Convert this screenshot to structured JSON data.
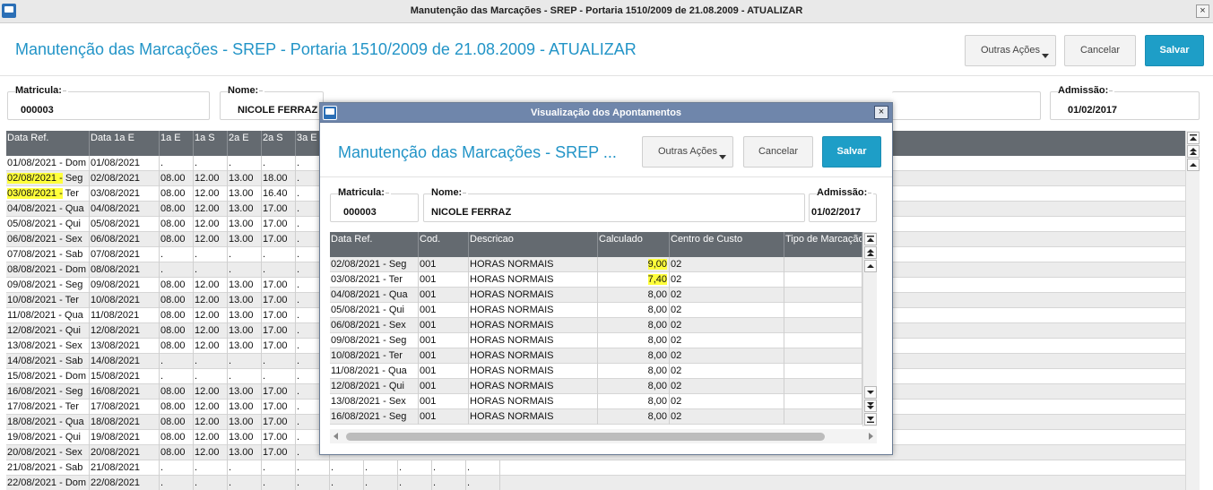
{
  "window": {
    "title": "Manutenção das Marcações - SREP - Portaria 1510/2009 de 21.08.2009 - ATUALIZAR",
    "close": "×"
  },
  "header": {
    "title": "Manutenção das Marcações - SREP - Portaria 1510/2009 de 21.08.2009 - ATUALIZAR",
    "outras_acoes": "Outras Ações",
    "cancelar": "Cancelar",
    "salvar": "Salvar"
  },
  "fields": {
    "matricula_label": "Matricula:",
    "matricula": "000003",
    "nome_label": "Nome:",
    "nome": "NICOLE FERRAZ",
    "admissao_label": "Admissão:",
    "admissao": "01/02/2017"
  },
  "grid": {
    "columns": [
      "Data Ref.",
      "Data 1a E",
      "1a E",
      "1a S",
      "2a E",
      "2a S",
      "3a E"
    ],
    "rows": [
      [
        "01/08/2021 - Dom",
        "01/08/2021",
        ".",
        ".",
        ".",
        ".",
        "."
      ],
      [
        "02/08/2021 - Seg",
        "02/08/2021",
        "08.00",
        "12.00",
        "13.00",
        "18.00",
        "."
      ],
      [
        "03/08/2021 - Ter",
        "03/08/2021",
        "08.00",
        "12.00",
        "13.00",
        "16.40",
        "."
      ],
      [
        "04/08/2021 - Qua",
        "04/08/2021",
        "08.00",
        "12.00",
        "13.00",
        "17.00",
        "."
      ],
      [
        "05/08/2021 - Qui",
        "05/08/2021",
        "08.00",
        "12.00",
        "13.00",
        "17.00",
        "."
      ],
      [
        "06/08/2021 - Sex",
        "06/08/2021",
        "08.00",
        "12.00",
        "13.00",
        "17.00",
        "."
      ],
      [
        "07/08/2021 - Sab",
        "07/08/2021",
        ".",
        ".",
        ".",
        ".",
        "."
      ],
      [
        "08/08/2021 - Dom",
        "08/08/2021",
        ".",
        ".",
        ".",
        ".",
        "."
      ],
      [
        "09/08/2021 - Seg",
        "09/08/2021",
        "08.00",
        "12.00",
        "13.00",
        "17.00",
        "."
      ],
      [
        "10/08/2021 - Ter",
        "10/08/2021",
        "08.00",
        "12.00",
        "13.00",
        "17.00",
        "."
      ],
      [
        "11/08/2021 - Qua",
        "11/08/2021",
        "08.00",
        "12.00",
        "13.00",
        "17.00",
        "."
      ],
      [
        "12/08/2021 - Qui",
        "12/08/2021",
        "08.00",
        "12.00",
        "13.00",
        "17.00",
        "."
      ],
      [
        "13/08/2021 - Sex",
        "13/08/2021",
        "08.00",
        "12.00",
        "13.00",
        "17.00",
        "."
      ],
      [
        "14/08/2021 - Sab",
        "14/08/2021",
        ".",
        ".",
        ".",
        ".",
        "."
      ],
      [
        "15/08/2021 - Dom",
        "15/08/2021",
        ".",
        ".",
        ".",
        ".",
        "."
      ],
      [
        "16/08/2021 - Seg",
        "16/08/2021",
        "08.00",
        "12.00",
        "13.00",
        "17.00",
        "."
      ],
      [
        "17/08/2021 - Ter",
        "17/08/2021",
        "08.00",
        "12.00",
        "13.00",
        "17.00",
        "."
      ],
      [
        "18/08/2021 - Qua",
        "18/08/2021",
        "08.00",
        "12.00",
        "13.00",
        "17.00",
        "."
      ],
      [
        "19/08/2021 - Qui",
        "19/08/2021",
        "08.00",
        "12.00",
        "13.00",
        "17.00",
        "."
      ],
      [
        "20/08/2021 - Sex",
        "20/08/2021",
        "08.00",
        "12.00",
        "13.00",
        "17.00",
        "."
      ],
      [
        "21/08/2021 - Sab",
        "21/08/2021",
        ".",
        ".",
        ".",
        ".",
        "."
      ],
      [
        "22/08/2021 - Dom",
        "22/08/2021",
        ".",
        ".",
        ".",
        ".",
        "."
      ]
    ],
    "extra_dots": [
      ".",
      ".",
      ".",
      ".",
      "."
    ]
  },
  "modal": {
    "title": "Visualização dos Apontamentos",
    "close": "×",
    "header_title": "Manutenção das Marcações - SREP ...",
    "outras_acoes": "Outras Ações",
    "cancelar": "Cancelar",
    "salvar": "Salvar",
    "fields": {
      "matricula_label": "Matricula:",
      "matricula": "000003",
      "nome_label": "Nome:",
      "nome": "NICOLE FERRAZ",
      "admissao_label": "Admissão:",
      "admissao": "01/02/2017"
    },
    "grid": {
      "columns": [
        "Data Ref.",
        "Cod.",
        "Descricao",
        "Calculado",
        "Centro de Custo",
        "Tipo de Marcação"
      ],
      "rows": [
        [
          "02/08/2021 - Seg",
          "001",
          "HORAS NORMAIS",
          "9,00",
          "02",
          ""
        ],
        [
          "03/08/2021 - Ter",
          "001",
          "HORAS NORMAIS",
          "7,40",
          "02",
          ""
        ],
        [
          "04/08/2021 - Qua",
          "001",
          "HORAS NORMAIS",
          "8,00",
          "02",
          ""
        ],
        [
          "05/08/2021 - Qui",
          "001",
          "HORAS NORMAIS",
          "8,00",
          "02",
          ""
        ],
        [
          "06/08/2021 - Sex",
          "001",
          "HORAS NORMAIS",
          "8,00",
          "02",
          ""
        ],
        [
          "09/08/2021 - Seg",
          "001",
          "HORAS NORMAIS",
          "8,00",
          "02",
          ""
        ],
        [
          "10/08/2021 - Ter",
          "001",
          "HORAS NORMAIS",
          "8,00",
          "02",
          ""
        ],
        [
          "11/08/2021 - Qua",
          "001",
          "HORAS NORMAIS",
          "8,00",
          "02",
          ""
        ],
        [
          "12/08/2021 - Qui",
          "001",
          "HORAS NORMAIS",
          "8,00",
          "02",
          ""
        ],
        [
          "13/08/2021 - Sex",
          "001",
          "HORAS NORMAIS",
          "8,00",
          "02",
          ""
        ],
        [
          "16/08/2021 - Seg",
          "001",
          "HORAS NORMAIS",
          "8,00",
          "02",
          ""
        ]
      ]
    }
  },
  "colors": {
    "accent": "#2294c7",
    "primary_button": "#1e9ec7",
    "grid_header": "#646a70",
    "highlight": "#ffff3a",
    "modal_title": "#6f86ab"
  }
}
